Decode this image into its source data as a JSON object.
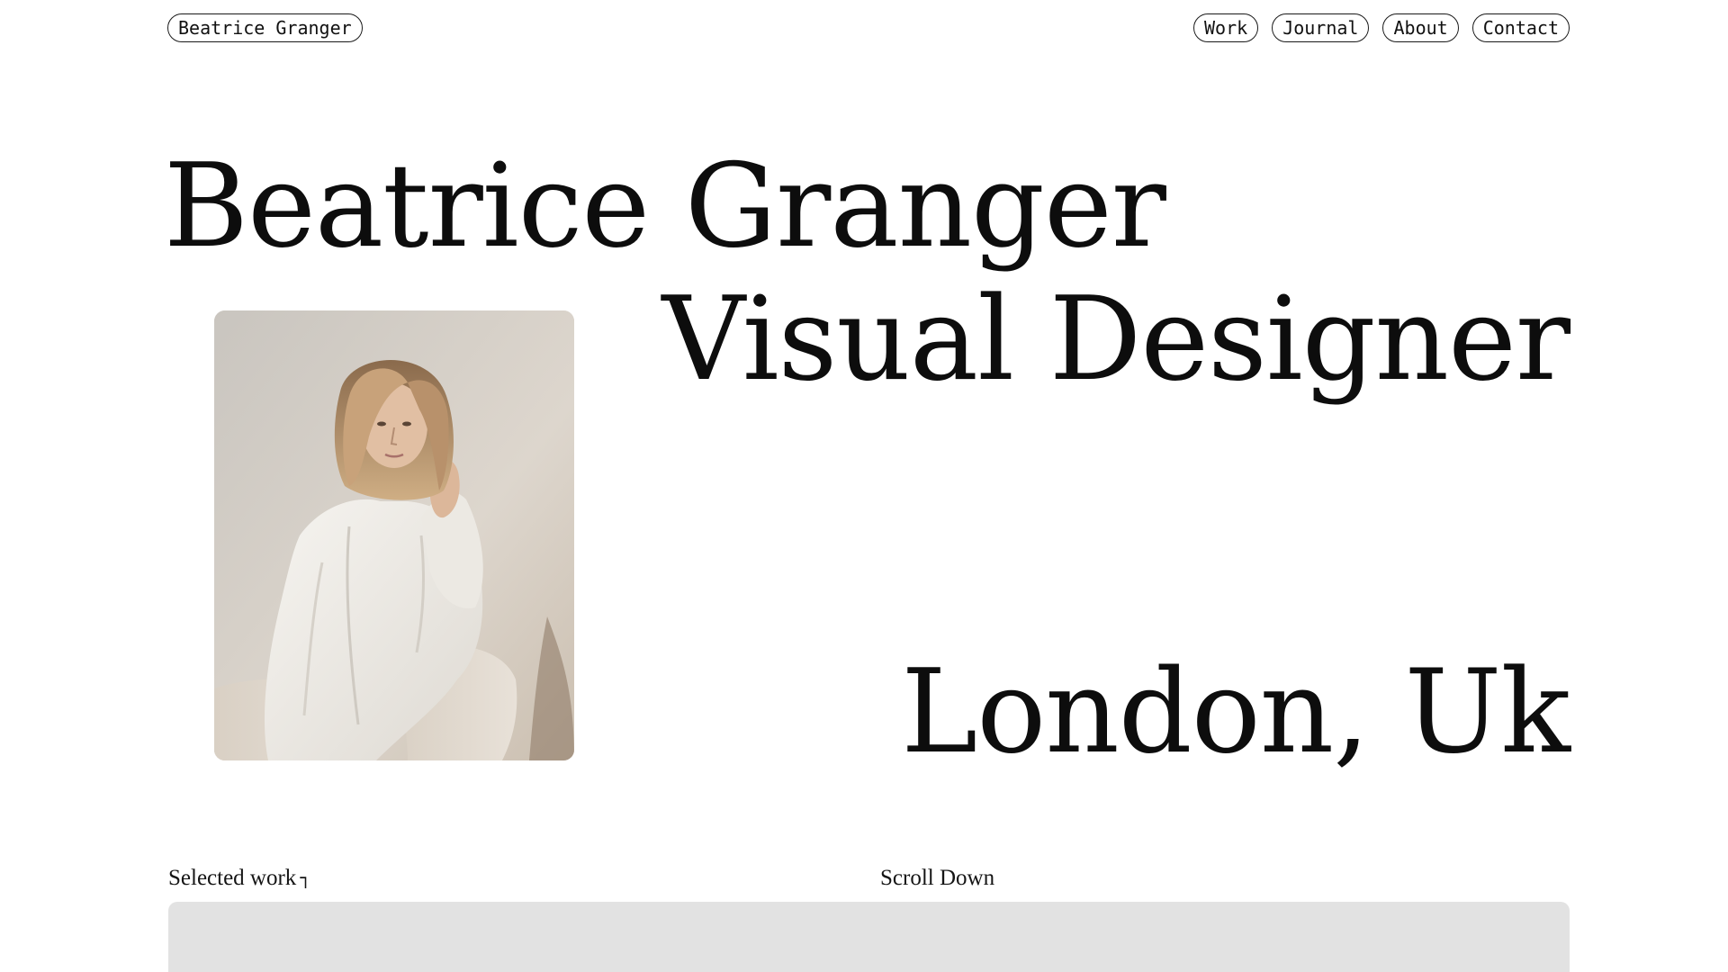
{
  "header": {
    "logo_label": "Beatrice Granger",
    "nav": [
      {
        "label": "Work"
      },
      {
        "label": "Journal"
      },
      {
        "label": "About"
      },
      {
        "label": "Contact"
      }
    ]
  },
  "hero": {
    "name": "Beatrice Granger",
    "role": "Visual Designer",
    "location": "London, Uk"
  },
  "sections": {
    "selected_work_label": "Selected work",
    "selected_work_icon": "corner-down-arrow-icon",
    "scroll_label": "Scroll Down"
  },
  "colors": {
    "background": "#ffffff",
    "text": "#111111",
    "panel": "#e2e2e2"
  }
}
